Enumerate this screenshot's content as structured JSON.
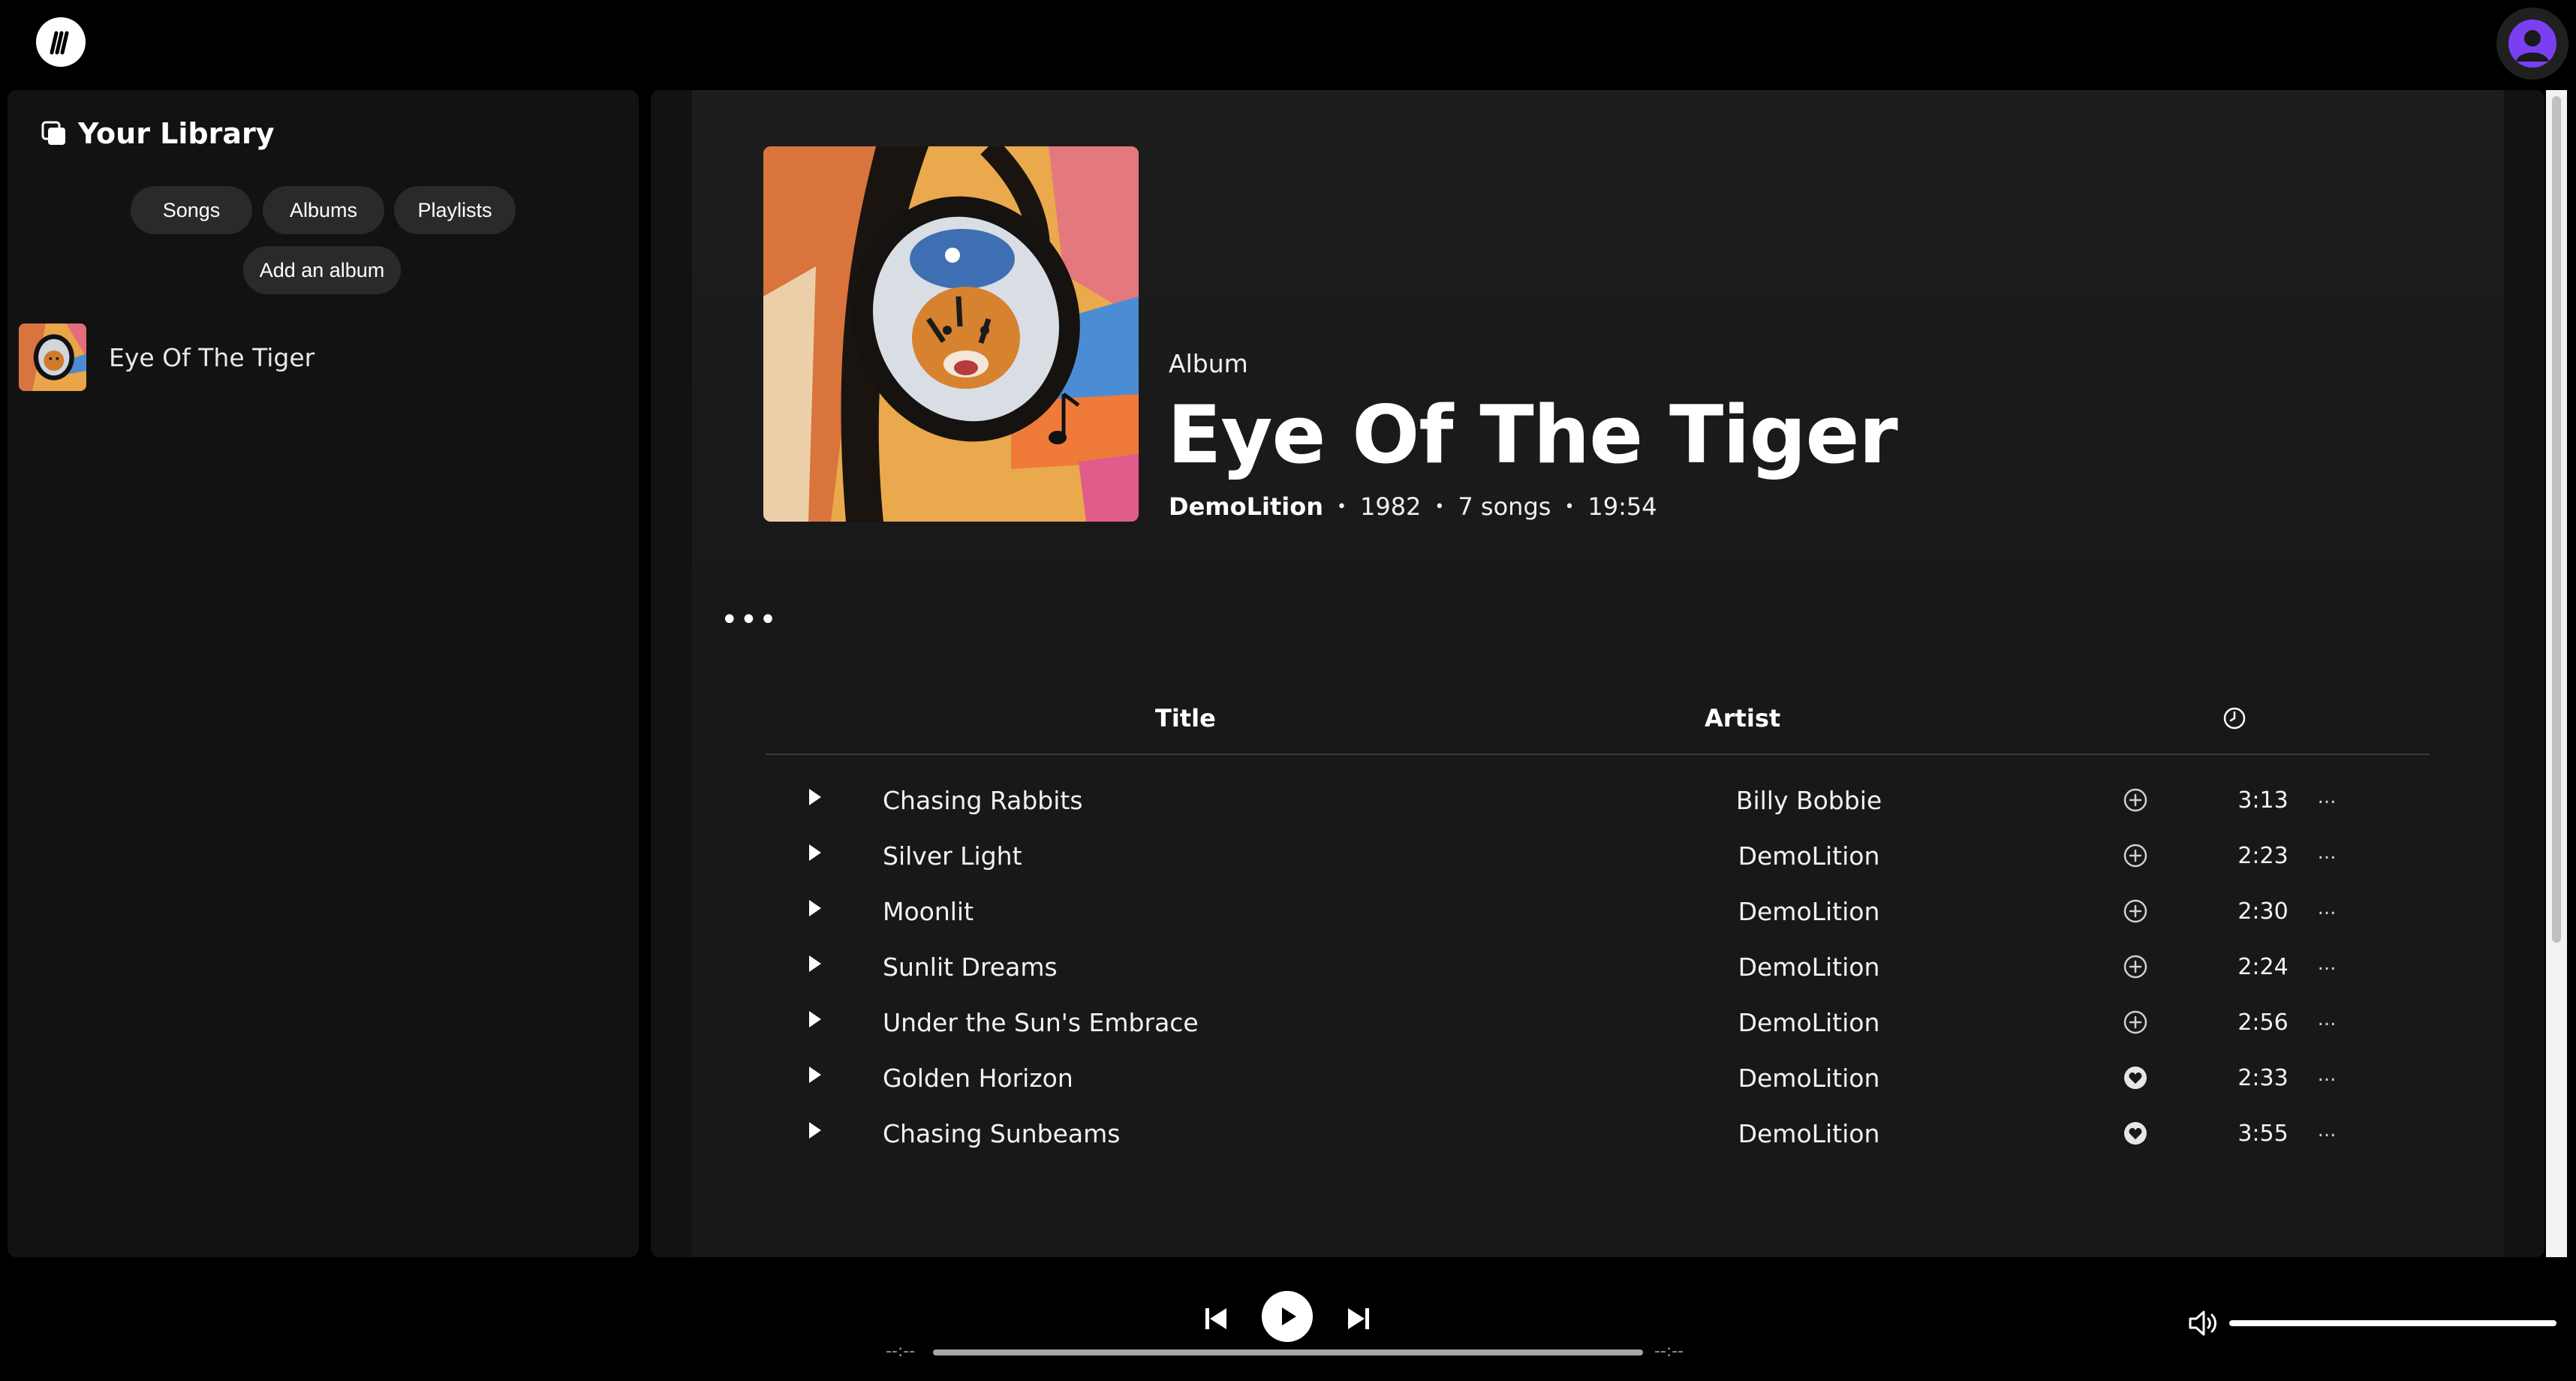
{
  "app": {
    "logo_icon": "m-logo-icon",
    "avatar_icon": "user-avatar-icon",
    "accent": "#7b3ff2"
  },
  "library": {
    "title": "Your Library",
    "icon": "library-icon",
    "filters": [
      "Songs",
      "Albums",
      "Playlists"
    ],
    "add_album": "Add an album",
    "items": [
      {
        "name": "Eye Of The Tiger"
      }
    ]
  },
  "album": {
    "label": "Album",
    "title": "Eye Of The Tiger",
    "artist": "DemoLition",
    "year": "1982",
    "song_count": "7 songs",
    "duration": "19:54",
    "more": "..."
  },
  "tracks": {
    "headers": {
      "title": "Title",
      "artist": "Artist",
      "duration_icon": "clock-icon"
    },
    "rows": [
      {
        "title": "Chasing Rabbits",
        "artist": "Billy Bobbie",
        "saved": false,
        "duration": "3:13"
      },
      {
        "title": "Silver Light",
        "artist": "DemoLition",
        "saved": false,
        "duration": "2:23"
      },
      {
        "title": "Moonlit",
        "artist": "DemoLition",
        "saved": false,
        "duration": "2:30"
      },
      {
        "title": "Sunlit Dreams",
        "artist": "DemoLition",
        "saved": false,
        "duration": "2:24"
      },
      {
        "title": "Under the Sun's Embrace",
        "artist": "DemoLition",
        "saved": false,
        "duration": "2:56"
      },
      {
        "title": "Golden Horizon",
        "artist": "DemoLition",
        "saved": true,
        "duration": "2:33"
      },
      {
        "title": "Chasing Sunbeams",
        "artist": "DemoLition",
        "saved": true,
        "duration": "3:55"
      }
    ],
    "row_more": "..."
  },
  "player": {
    "time_elapsed": "--:--",
    "time_total": "--:--",
    "progress": 0,
    "volume": 1.0
  }
}
